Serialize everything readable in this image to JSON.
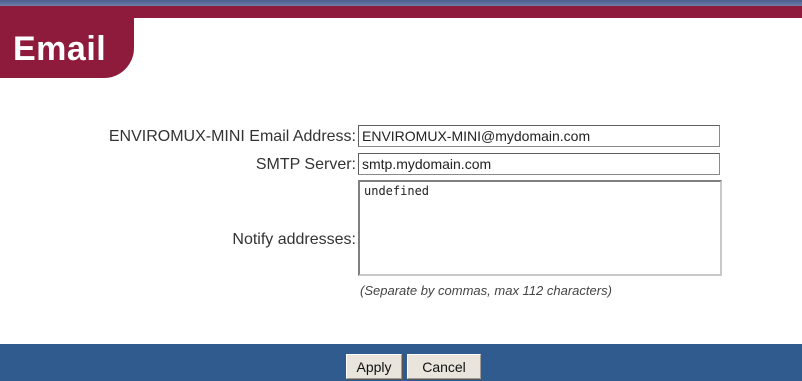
{
  "header": {
    "title": "Email"
  },
  "form": {
    "email_address": {
      "label": "ENVIROMUX-MINI Email Address:",
      "value": "ENVIROMUX-MINI@mydomain.com"
    },
    "smtp_server": {
      "label": "SMTP Server:",
      "value": "smtp.mydomain.com"
    },
    "notify_addresses": {
      "label": "Notify addresses:",
      "value": "undefined",
      "hint": "(Separate by commas, max 112 characters)"
    }
  },
  "actions": {
    "apply_label": "Apply",
    "cancel_label": "Cancel"
  },
  "colors": {
    "brand": "#8e1b3c",
    "bottom_bar": "#2f5b8e"
  }
}
